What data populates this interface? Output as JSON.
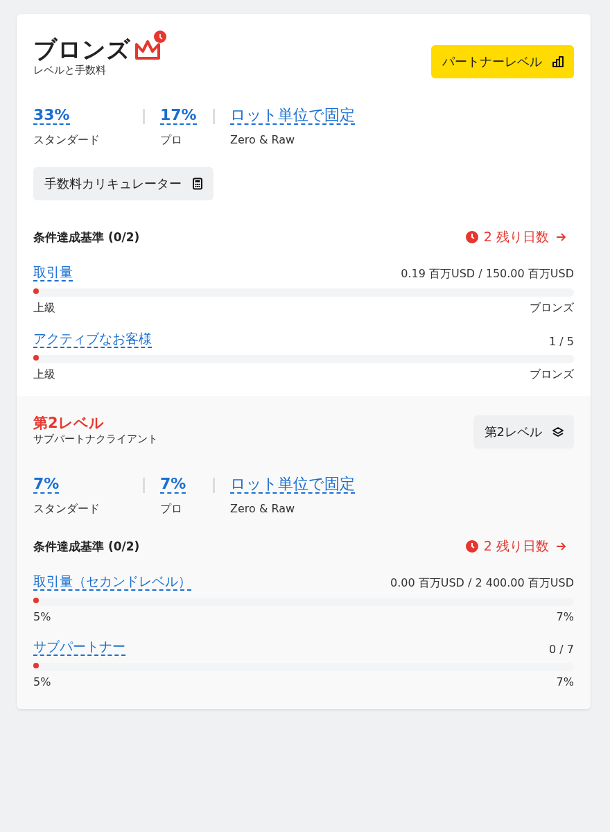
{
  "sections": [
    {
      "kind": "tier",
      "title": "ブロンズ",
      "subtitle": "レベルと手数料",
      "button": "パートナーレベル",
      "rates": [
        {
          "value": "33%",
          "label": "スタンダード"
        },
        {
          "value": "17%",
          "label": "プロ"
        },
        {
          "value": "ロット単位で固定",
          "label": "Zero & Raw"
        }
      ],
      "calculator": "手数料カリキュレーター",
      "criteria": {
        "title": "条件達成基準 (0/2)",
        "days": "2 残り日数",
        "items": [
          {
            "name": "取引量",
            "value": "0.19 百万USD / 150.00 百万USD",
            "level": 0.01,
            "from": "上級",
            "to": "ブロンズ"
          },
          {
            "name": "アクティブなお客様",
            "value": "1 / 5",
            "level": 0.01,
            "from": "上級",
            "to": "ブロンズ"
          }
        ]
      }
    },
    {
      "kind": "sub",
      "title": "第2レベル",
      "subtitle": "サブパートナクライアント",
      "button": "第2レベル",
      "rates": [
        {
          "value": "7%",
          "label": "スタンダード"
        },
        {
          "value": "7%",
          "label": "プロ"
        },
        {
          "value": "ロット単位で固定",
          "label": "Zero & Raw"
        }
      ],
      "criteria": {
        "title": "条件達成基準 (0/2)",
        "days": "2 残り日数",
        "items": [
          {
            "name": "取引量（セカンドレベル）",
            "value": "0.00 百万USD / 2 400.00 百万USD",
            "level": 0.01,
            "from": "5%",
            "to": "7%"
          },
          {
            "name": "サブパートナー",
            "value": "0 / 7",
            "level": 0.01,
            "from": "5%",
            "to": "7%"
          }
        ]
      }
    }
  ]
}
